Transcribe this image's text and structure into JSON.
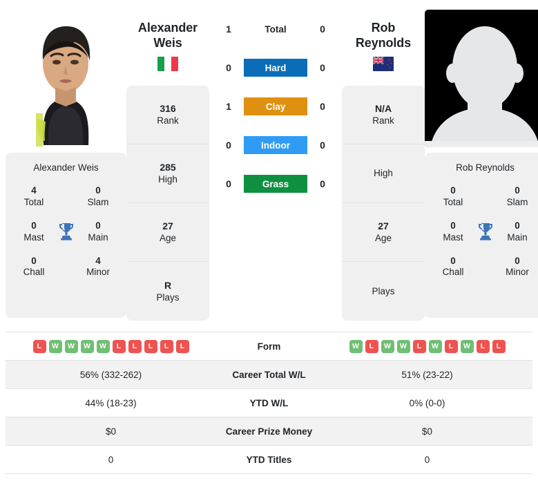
{
  "players": {
    "left": {
      "display_name_line1": "Alexander",
      "display_name_line2": "Weis",
      "full_name": "Alexander Weis",
      "country": "Italy",
      "flag_icon": "flag-italy",
      "photo_type": "headshot-photo",
      "rank": "316",
      "rank_label": "Rank",
      "high": "285",
      "high_label": "High",
      "age": "27",
      "age_label": "Age",
      "plays": "R",
      "plays_label": "Plays",
      "titles": {
        "total": "4",
        "total_label": "Total",
        "slam": "0",
        "slam_label": "Slam",
        "mast": "0",
        "mast_label": "Mast",
        "main": "0",
        "main_label": "Main",
        "chall": "0",
        "chall_label": "Chall",
        "minor": "4",
        "minor_label": "Minor"
      },
      "form": [
        "L",
        "W",
        "W",
        "W",
        "W",
        "L",
        "L",
        "L",
        "L",
        "L"
      ],
      "career_total_wl": "56% (332-262)",
      "ytd_wl": "44% (18-23)",
      "career_prize_money": "$0",
      "ytd_titles": "0"
    },
    "right": {
      "display_name_line1": "Rob",
      "display_name_line2": "Reynolds",
      "full_name": "Rob Reynolds",
      "country": "New Zealand",
      "flag_icon": "flag-new-zealand",
      "photo_type": "placeholder-avatar",
      "rank": "N/A",
      "rank_label": "Rank",
      "high": "",
      "high_label": "High",
      "age": "27",
      "age_label": "Age",
      "plays": "",
      "plays_label": "Plays",
      "titles": {
        "total": "0",
        "total_label": "Total",
        "slam": "0",
        "slam_label": "Slam",
        "mast": "0",
        "mast_label": "Mast",
        "main": "0",
        "main_label": "Main",
        "chall": "0",
        "chall_label": "Chall",
        "minor": "0",
        "minor_label": "Minor"
      },
      "form": [
        "W",
        "L",
        "W",
        "W",
        "L",
        "W",
        "L",
        "W",
        "L",
        "L"
      ],
      "career_total_wl": "51% (23-22)",
      "ytd_wl": "0% (0-0)",
      "career_prize_money": "$0",
      "ytd_titles": "0"
    }
  },
  "head_to_head": {
    "rows": [
      {
        "label": "Total",
        "left": "1",
        "right": "0",
        "style": "plain",
        "color": ""
      },
      {
        "label": "Hard",
        "left": "0",
        "right": "0",
        "style": "badge",
        "color": "#0b6cb8"
      },
      {
        "label": "Clay",
        "left": "1",
        "right": "0",
        "style": "badge",
        "color": "#e09010"
      },
      {
        "label": "Indoor",
        "left": "0",
        "right": "0",
        "style": "badge",
        "color": "#2f9bf5"
      },
      {
        "label": "Grass",
        "left": "0",
        "right": "0",
        "style": "badge",
        "color": "#0f9040"
      }
    ]
  },
  "stats_table": {
    "rows": [
      {
        "label": "Form",
        "type": "form"
      },
      {
        "label": "Career Total W/L",
        "type": "text",
        "left": "56% (332-262)",
        "right": "51% (23-22)"
      },
      {
        "label": "YTD W/L",
        "type": "text",
        "left": "44% (18-23)",
        "right": "0% (0-0)"
      },
      {
        "label": "Career Prize Money",
        "type": "text",
        "left": "$0",
        "right": "$0"
      },
      {
        "label": "YTD Titles",
        "type": "text",
        "left": "0",
        "right": "0"
      }
    ]
  },
  "colors": {
    "hard": "#0b6cb8",
    "clay": "#e09010",
    "indoor": "#2f9bf5",
    "grass": "#0f9040",
    "win": "#70bf73",
    "loss": "#ef5350",
    "card_bg": "#f0f0f0",
    "trophy": "#3c74b8"
  },
  "icons": {
    "trophy": "trophy-icon"
  }
}
